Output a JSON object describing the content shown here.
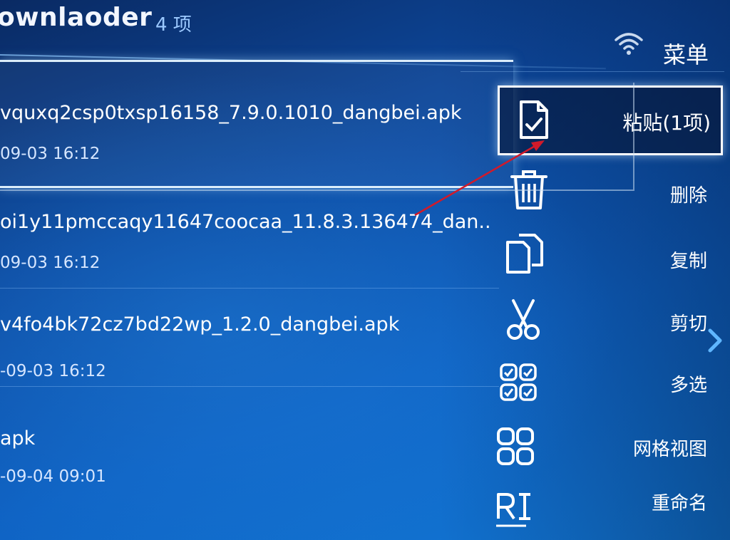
{
  "header": {
    "app_title": "ownlaoder",
    "item_count": "4 项",
    "wifi_icon": "wifi-icon",
    "menu_title": "菜单"
  },
  "files": [
    {
      "name": "vquxq2csp0txsp16158_7.9.0.1010_dangbei.apk",
      "date": "09-03 16:12",
      "icon": "apk-file"
    },
    {
      "name": "oi1y11pmccaqy11647coocaa_11.8.3.136474_dan..",
      "date": "09-03 16:12",
      "icon": "apk-file"
    },
    {
      "name": "v4fo4bk72cz7bd22wp_1.2.0_dangbei.apk",
      "date": "-09-03 16:12",
      "icon": "apk-file"
    },
    {
      "name": "apk",
      "date": "-09-04 09:01",
      "icon": "apk-file"
    }
  ],
  "menu": {
    "items": [
      {
        "label": "粘贴(1项)",
        "icon": "paste-icon",
        "focused": true
      },
      {
        "label": "删除",
        "icon": "trash-icon"
      },
      {
        "label": "复制",
        "icon": "copy-icon"
      },
      {
        "label": "剪切",
        "icon": "scissors-icon"
      },
      {
        "label": "多选",
        "icon": "multi-select-icon"
      },
      {
        "label": "网格视图",
        "icon": "grid-view-icon"
      },
      {
        "label": "重命名",
        "icon": "rename-icon"
      }
    ],
    "more_icon": "chevron-right-icon"
  },
  "colors": {
    "background_dark": "#0a2a63",
    "background_light": "#1279d6",
    "accent_count": "#9cc9ff",
    "annotation_arrow": "#d11a2a"
  }
}
